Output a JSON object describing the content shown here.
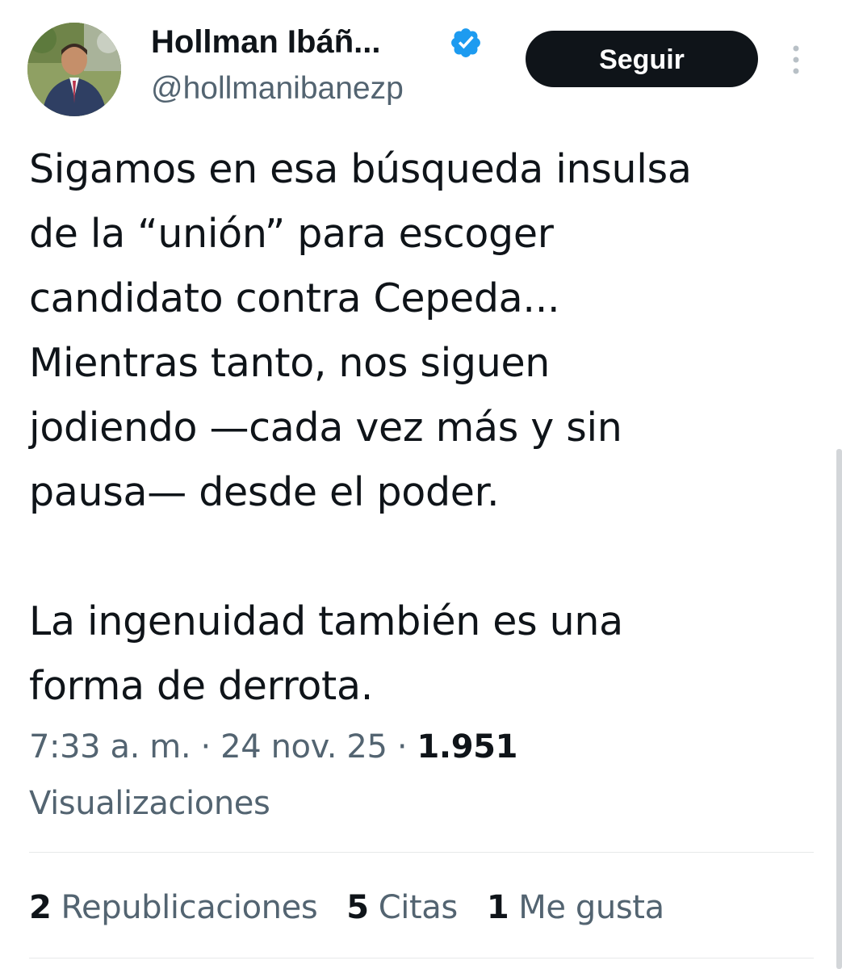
{
  "author": {
    "display_name": "Hollman Ibáñ...",
    "handle": "@hollmanibanezp",
    "verified_icon": "verified-badge-icon",
    "verified_color": "#1d9bf0"
  },
  "actions": {
    "follow_label": "Seguir",
    "more_icon": "more-vertical-icon"
  },
  "tweet": {
    "paragraph_1_lines": [
      "Sigamos en esa búsqueda insulsa",
      "de la “unión” para escoger",
      "candidato contra Cepeda...",
      "Mientras tanto, nos siguen",
      "jodiendo —cada vez más y sin",
      "pausa— desde el poder."
    ],
    "paragraph_2_lines": [
      "La ingenuidad también es una",
      "forma de derrota."
    ]
  },
  "meta": {
    "time": "7:33 a. m.",
    "separator": "·",
    "date": "24 nov. 25",
    "views_count": "1.951",
    "views_label": "Visualizaciones"
  },
  "stats": {
    "reposts_count": "2",
    "reposts_label": "Republicaciones",
    "quotes_count": "5",
    "quotes_label": "Citas",
    "likes_count": "1",
    "likes_label": "Me gusta"
  },
  "colors": {
    "text_primary": "#0f1419",
    "text_secondary": "#536471",
    "button_bg": "#0f1419",
    "divider": "#e7e9ea"
  }
}
